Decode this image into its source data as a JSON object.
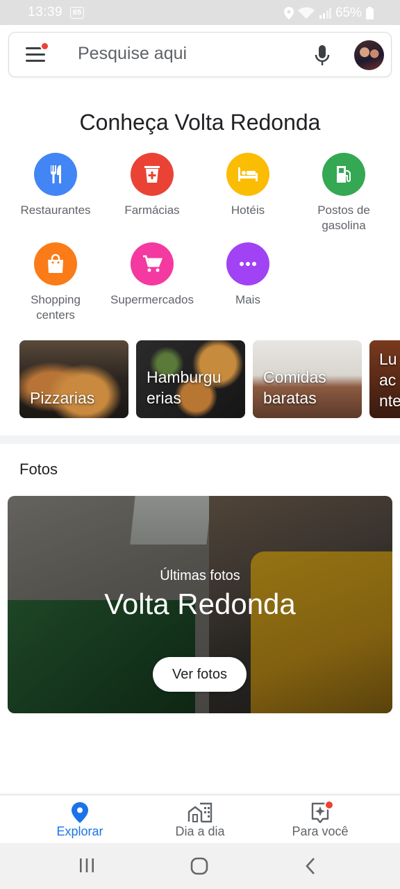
{
  "status_bar": {
    "time": "13:39",
    "notification_badge": "65",
    "battery": "65%"
  },
  "search": {
    "placeholder": "Pesquise aqui"
  },
  "explore": {
    "title": "Conheça Volta Redonda",
    "categories": [
      {
        "label": "Restaurantes",
        "icon": "fork-knife-icon",
        "color": "#4285f4"
      },
      {
        "label": "Farmácias",
        "icon": "pharmacy-icon",
        "color": "#ea4335"
      },
      {
        "label": "Hotéis",
        "icon": "bed-icon",
        "color": "#fbbc04"
      },
      {
        "label": "Postos de\ngasolina",
        "icon": "gas-station-icon",
        "color": "#34a853"
      },
      {
        "label": "Shopping\ncenters",
        "icon": "shopping-bag-icon",
        "color": "#fa7b17"
      },
      {
        "label": "Supermercados",
        "icon": "cart-icon",
        "color": "#f439a0"
      },
      {
        "label": "Mais",
        "icon": "more-icon",
        "color": "#a142f4"
      }
    ],
    "tiles": [
      {
        "label": "Pizzarias"
      },
      {
        "label": "Hamburgu\nerias"
      },
      {
        "label": "Comidas\nbaratas"
      },
      {
        "label": "Lu\nac\nnte"
      }
    ]
  },
  "photos": {
    "heading": "Fotos",
    "subtitle": "Últimas fotos",
    "title": "Volta Redonda",
    "button": "Ver fotos"
  },
  "bottom_nav": [
    {
      "label": "Explorar",
      "icon": "location-pin-icon",
      "active": true
    },
    {
      "label": "Dia a dia",
      "icon": "commute-buildings-icon",
      "active": false
    },
    {
      "label": "Para você",
      "icon": "sparkle-icon",
      "active": false
    }
  ],
  "colors": {
    "accent": "#1a73e8",
    "badge": "#ea4335"
  }
}
